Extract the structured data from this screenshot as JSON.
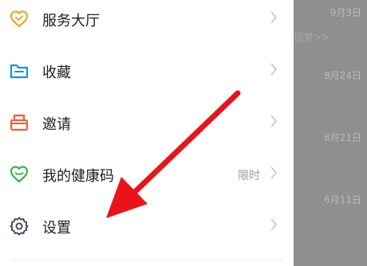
{
  "background": {
    "dates": [
      "9月3日",
      "8月24日",
      "8月21日",
      "6月11日"
    ],
    "snippet": "圆梦>>"
  },
  "menu": {
    "items": [
      {
        "label": "服务大厅",
        "icon": "heart-icon",
        "note": ""
      },
      {
        "label": "收藏",
        "icon": "folder-icon",
        "note": ""
      },
      {
        "label": "邀请",
        "icon": "invite-icon",
        "note": ""
      },
      {
        "label": "我的健康码",
        "icon": "health-code-icon",
        "note": "限时"
      },
      {
        "label": "设置",
        "icon": "gear-icon",
        "note": ""
      }
    ]
  },
  "colors": {
    "heart": "#f0a52a",
    "folder": "#1e8fe6",
    "invite": "#e8613c",
    "health": "#3ab54a",
    "gear": "#3a4a5a",
    "arrow": "#e8141a"
  }
}
